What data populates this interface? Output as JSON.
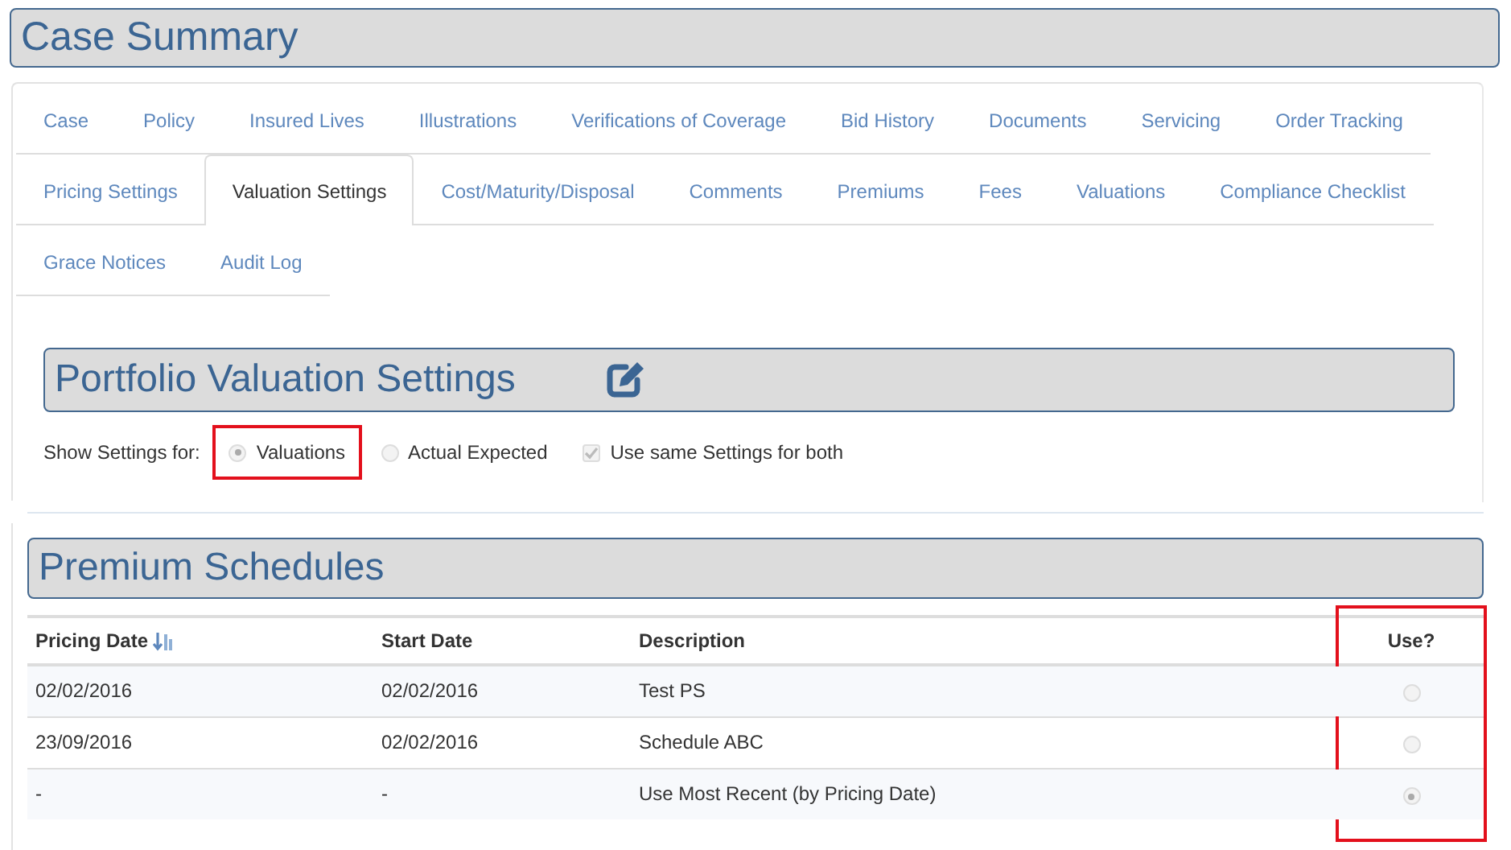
{
  "page_title": "Case Summary",
  "tab_rows": [
    {
      "tabs": [
        {
          "label": "Case",
          "selected": false
        },
        {
          "label": "Policy",
          "selected": false
        },
        {
          "label": "Insured Lives",
          "selected": false
        },
        {
          "label": "Illustrations",
          "selected": false
        },
        {
          "label": "Verifications of Coverage",
          "selected": false
        },
        {
          "label": "Bid History",
          "selected": false
        },
        {
          "label": "Documents",
          "selected": false
        },
        {
          "label": "Servicing",
          "selected": false
        },
        {
          "label": "Order Tracking",
          "selected": false
        }
      ]
    },
    {
      "tabs": [
        {
          "label": "Pricing Settings",
          "selected": false
        },
        {
          "label": "Valuation Settings",
          "selected": true
        },
        {
          "label": "Cost/Maturity/Disposal",
          "selected": false
        },
        {
          "label": "Comments",
          "selected": false
        },
        {
          "label": "Premiums",
          "selected": false
        },
        {
          "label": "Fees",
          "selected": false
        },
        {
          "label": "Valuations",
          "selected": false
        },
        {
          "label": "Compliance Checklist",
          "selected": false
        }
      ]
    },
    {
      "tabs": [
        {
          "label": "Grace Notices",
          "selected": false
        },
        {
          "label": "Audit Log",
          "selected": false
        }
      ]
    }
  ],
  "valuation_settings": {
    "title": "Portfolio Valuation Settings",
    "show_label": "Show Settings for:",
    "options": [
      {
        "kind": "radio",
        "label": "Valuations",
        "selected": true,
        "highlighted": true
      },
      {
        "kind": "radio",
        "label": "Actual Expected",
        "selected": false,
        "highlighted": false
      },
      {
        "kind": "checkbox",
        "label": "Use same Settings for both",
        "checked": true,
        "highlighted": false
      }
    ]
  },
  "premium_schedules": {
    "title": "Premium Schedules",
    "columns": [
      {
        "label": "Pricing Date",
        "sorted": true,
        "highlighted": false
      },
      {
        "label": "Start Date",
        "sorted": false,
        "highlighted": false
      },
      {
        "label": "Description",
        "sorted": false,
        "highlighted": false
      },
      {
        "label": "Use?",
        "sorted": false,
        "highlighted": true
      }
    ],
    "rows": [
      {
        "pricing_date": "02/02/2016",
        "start_date": "02/02/2016",
        "description": "Test PS",
        "selected": false
      },
      {
        "pricing_date": "23/09/2016",
        "start_date": "02/02/2016",
        "description": "Schedule ABC",
        "selected": false
      },
      {
        "pricing_date": "-",
        "start_date": "-",
        "description": "Use Most Recent (by Pricing Date)",
        "selected": true
      }
    ]
  }
}
